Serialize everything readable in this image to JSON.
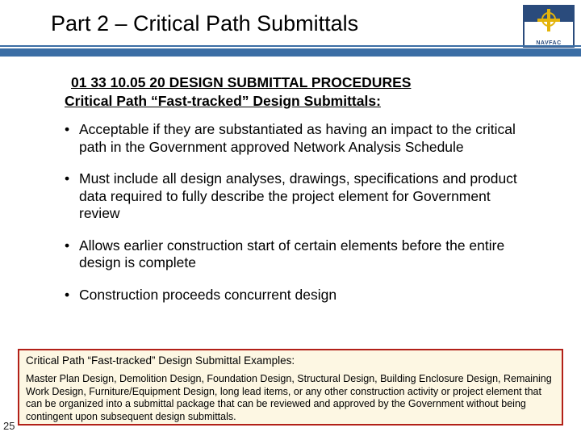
{
  "logo_text": "NAVFAC",
  "title": "Part 2 – Critical Path Submittals",
  "section": {
    "code": "01 33 10.05 20 DESIGN SUBMITTAL PROCEDURES",
    "heading": "Critical Path “Fast-tracked” Design Submittals:"
  },
  "bullets": [
    "Acceptable if they are substantiated as having an impact to the critical path in the Government approved Network Analysis Schedule",
    "Must include all design analyses, drawings, specifications and product data required to fully describe the project element for Government review",
    "Allows earlier construction start of certain elements before the entire design is complete",
    "Construction proceeds concurrent design"
  ],
  "examples": {
    "title": "Critical Path “Fast-tracked” Design Submittal Examples:",
    "body": "Master Plan Design, Demolition Design, Foundation Design, Structural Design, Building Enclosure Design, Remaining Work Design, Furniture/Equipment Design, long lead items, or any other construction activity or project element that can be organized into a submittal package that can be reviewed and approved by the Government without being contingent upon subsequent design submittals."
  },
  "slide_number": "25"
}
